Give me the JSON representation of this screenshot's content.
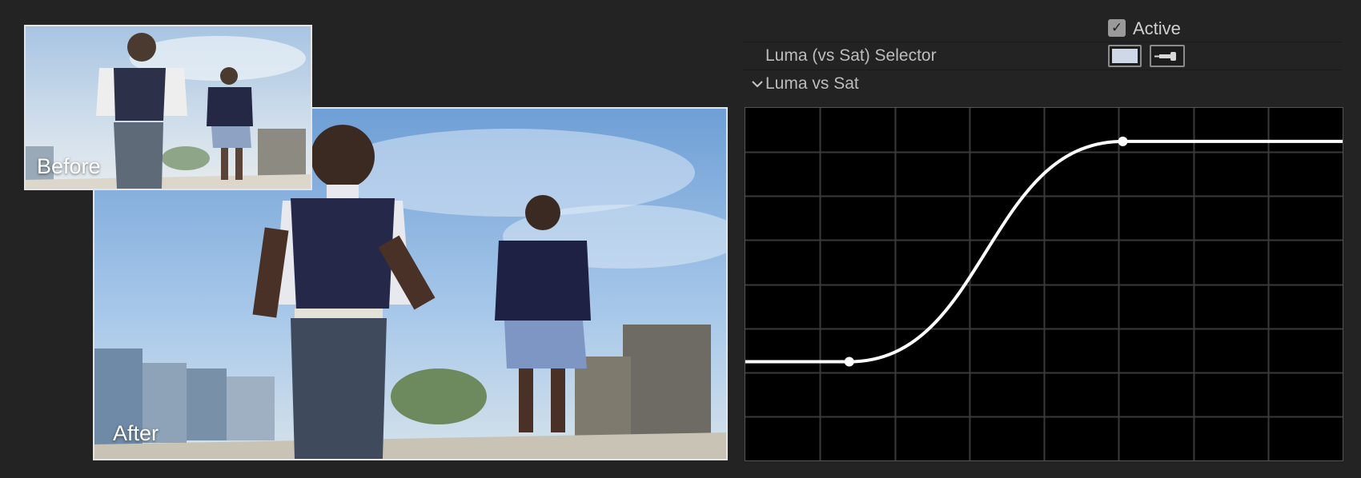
{
  "previews": {
    "before_label": "Before",
    "after_label": "After"
  },
  "controls": {
    "active_label": "Active",
    "active_checked": true,
    "selector_label": "Luma (vs Sat) Selector",
    "selected_color": "#cfd8e6",
    "eyedropper_icon": "eyedropper-icon",
    "section_label": "Luma vs Sat",
    "section_expanded": true
  },
  "curve": {
    "grid_color": "#3a3a3a",
    "curve_color": "#ffffff",
    "points": [
      {
        "x": 0.174,
        "y": 0.28
      },
      {
        "x": 0.632,
        "y": 0.905
      }
    ]
  }
}
